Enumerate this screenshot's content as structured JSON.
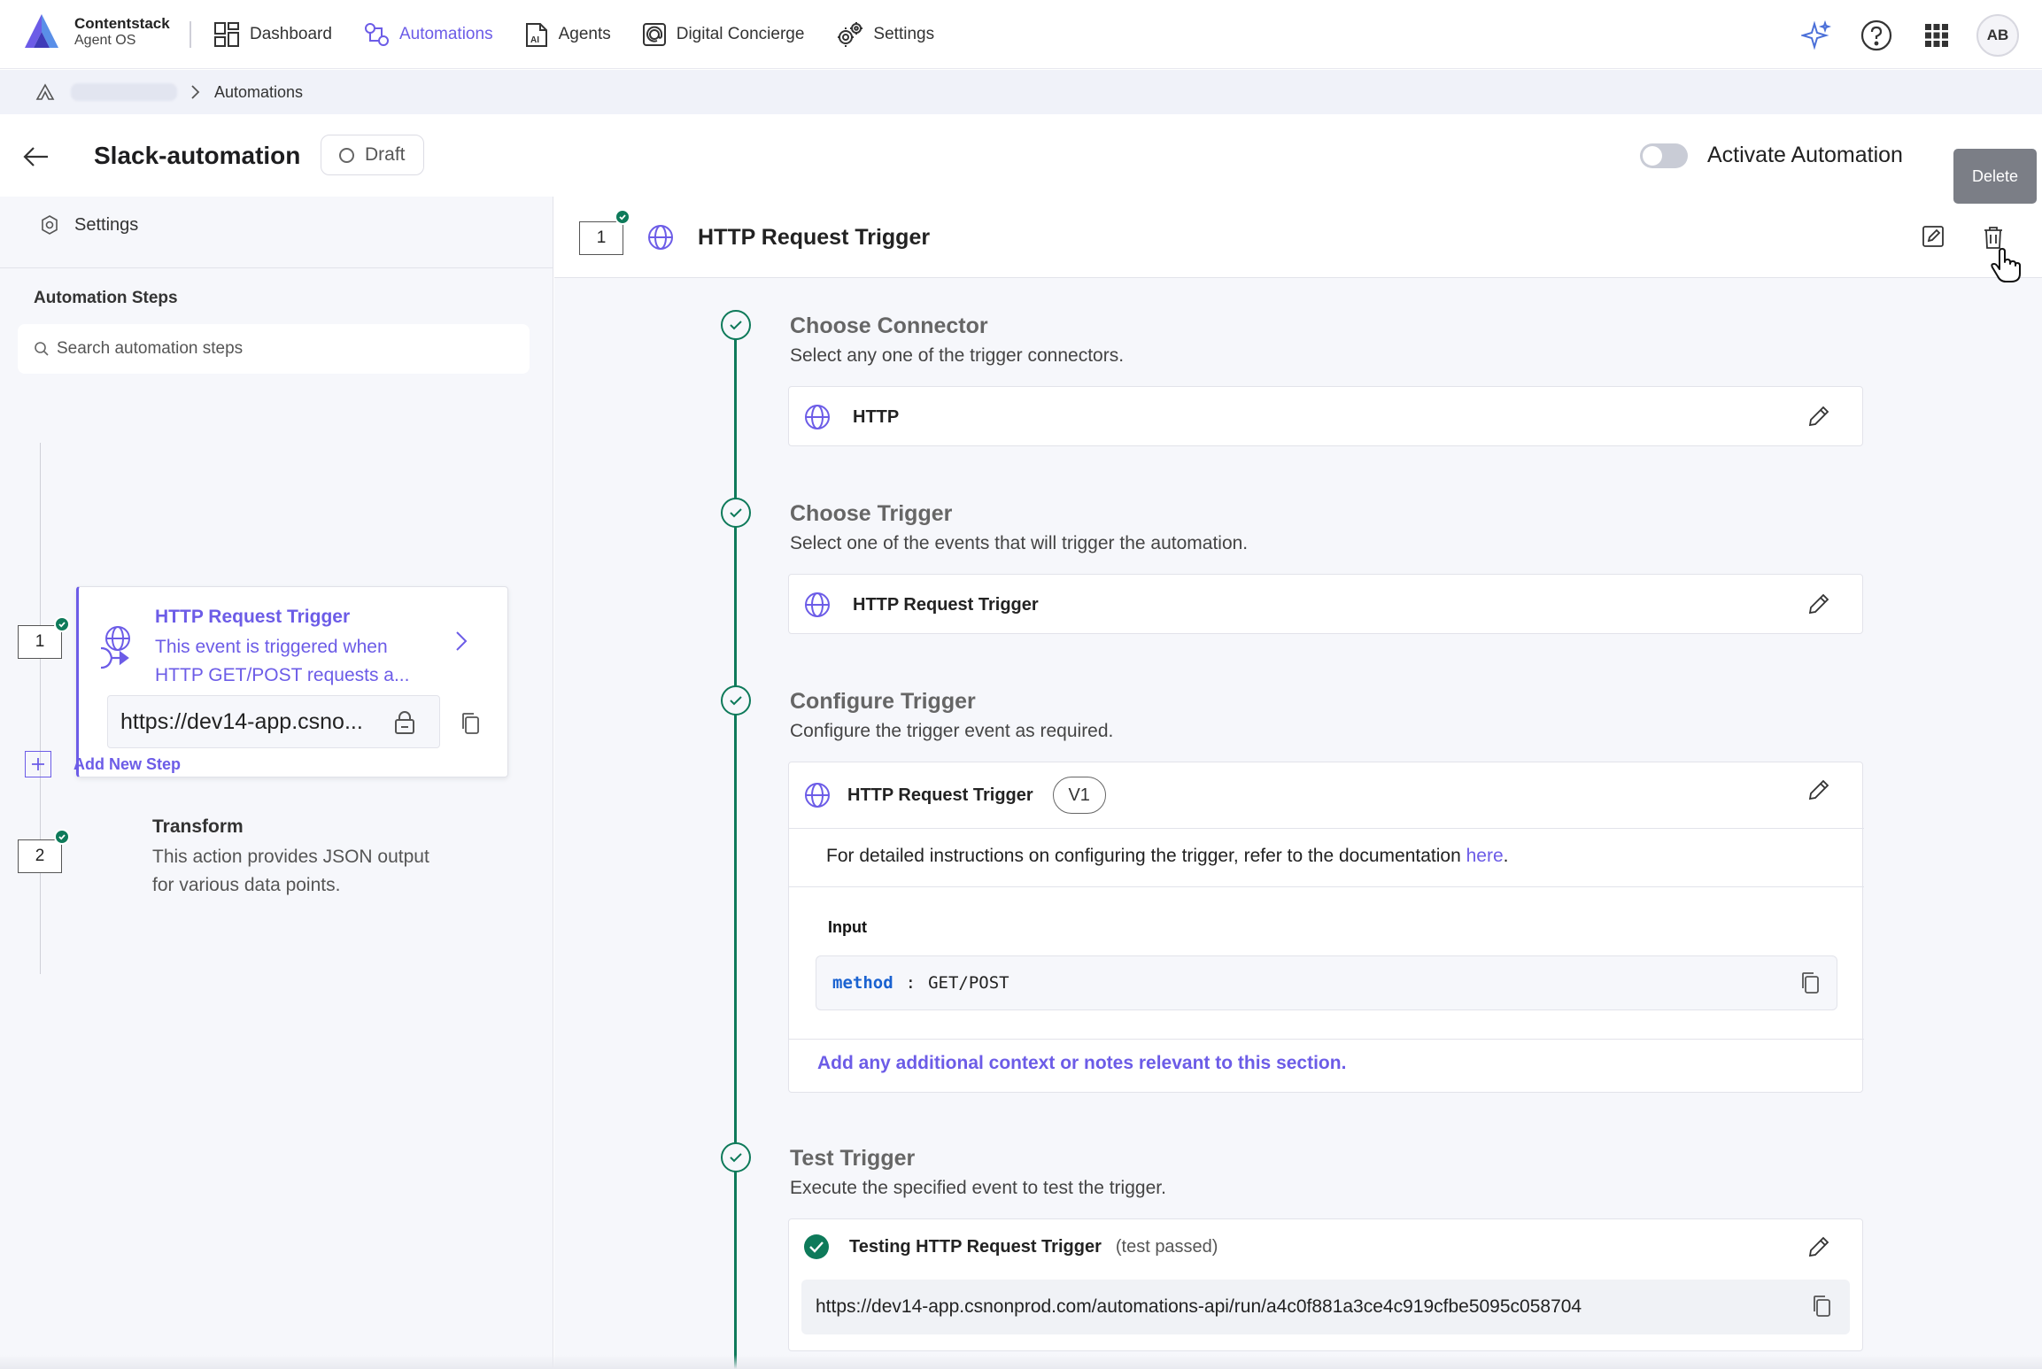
{
  "app": {
    "brand_name": "Contentstack",
    "brand_sub": "Agent OS",
    "accent_color": "#6c5ce7",
    "success_color": "#0e7a5a"
  },
  "nav": {
    "items": [
      {
        "label": "Dashboard",
        "icon": "dashboard-icon",
        "active": false
      },
      {
        "label": "Automations",
        "icon": "automations-icon",
        "active": true
      },
      {
        "label": "Agents",
        "icon": "agents-icon",
        "active": false
      },
      {
        "label": "Digital Concierge",
        "icon": "concierge-icon",
        "active": false
      },
      {
        "label": "Settings",
        "icon": "gear-icon",
        "active": false
      }
    ],
    "avatar_initials": "AB"
  },
  "breadcrumb": {
    "current": "Automations"
  },
  "header": {
    "title": "Slack-automation",
    "status": "Draft",
    "activate_label": "Activate Automation",
    "activate_on": false,
    "tooltip": "Delete"
  },
  "sidebar": {
    "settings_label": "Settings",
    "steps_heading": "Automation Steps",
    "search_placeholder": "Search automation steps",
    "steps": [
      {
        "number": "1",
        "title": "HTTP Request Trigger",
        "desc": "This event is triggered when HTTP GET/POST requests a...",
        "url": "https://dev14-app.csno..."
      },
      {
        "number": "2",
        "title": "Transform",
        "desc": "This action provides JSON output for various data points."
      }
    ],
    "add_step_label": "Add New Step"
  },
  "main": {
    "step_number": "1",
    "step_title": "HTTP Request Trigger",
    "sections": {
      "connector": {
        "title": "Choose Connector",
        "subtitle": "Select any one of the trigger connectors.",
        "value": "HTTP"
      },
      "trigger": {
        "title": "Choose Trigger",
        "subtitle": "Select one of the events that will trigger the automation.",
        "value": "HTTP Request Trigger"
      },
      "configure": {
        "title": "Configure Trigger",
        "subtitle": "Configure the trigger event as required.",
        "value": "HTTP Request Trigger",
        "version": "V1",
        "doc_text": "For detailed instructions on configuring the trigger, refer to the documentation",
        "doc_link": "here",
        "doc_period": ".",
        "input_label": "Input",
        "input_key": "method",
        "input_sep": ":",
        "input_value": "GET/POST",
        "notes_link": "Add any additional context or notes relevant to this section."
      },
      "test": {
        "title": "Test Trigger",
        "subtitle": "Execute the specified event to test the trigger.",
        "value": "Testing HTTP Request Trigger",
        "status": "(test passed)",
        "url": "https://dev14-app.csnonprod.com/automations-api/run/a4c0f881a3ce4c919cfbe5095c058704"
      }
    }
  }
}
